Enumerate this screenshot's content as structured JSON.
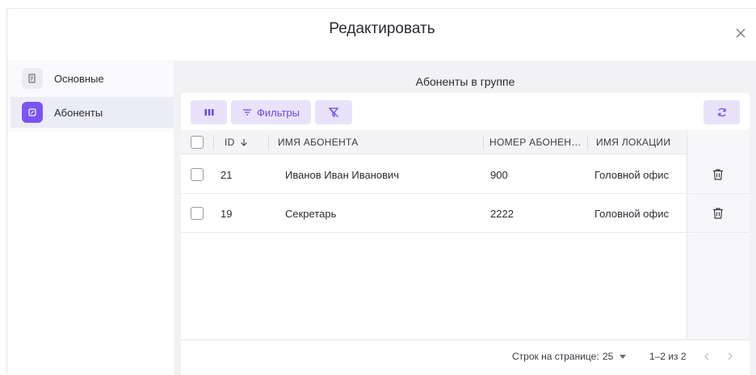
{
  "dialog": {
    "title": "Редактировать",
    "close_icon": "close-icon"
  },
  "sidebar": {
    "items": [
      {
        "label": "Основные",
        "icon": "document-icon",
        "active": false
      },
      {
        "label": "Абоненты",
        "icon": "subscriber-icon",
        "active": true
      }
    ]
  },
  "panel": {
    "title": "Абоненты в группе"
  },
  "toolbar": {
    "columns_icon": "columns-icon",
    "filters_label": "Фильтры",
    "filters_icon": "filter-lines-icon",
    "clear_filters_icon": "filter-clear-icon",
    "refresh_icon": "refresh-icon"
  },
  "table": {
    "headers": {
      "id": "ID",
      "name": "ИМЯ АБОНЕНТА",
      "number": "НОМЕР АБОНЕН…",
      "location": "ИМЯ ЛОКАЦИИ"
    },
    "sort": {
      "column": "id",
      "direction": "desc",
      "icon": "arrow-down-icon"
    },
    "rows": [
      {
        "id": "21",
        "name": "Иванов Иван Иванович",
        "number": "900",
        "location": "Головной офис"
      },
      {
        "id": "19",
        "name": "Секретарь",
        "number": "2222",
        "location": "Головной офис"
      }
    ]
  },
  "footer": {
    "rows_per_page_label": "Строк на странице:",
    "rows_per_page_value": "25",
    "range": "1–2 из 2"
  },
  "colors": {
    "accent": "#6b46f0",
    "accent_light": "#e8e3fb",
    "active_item_bg": "#ececf6"
  }
}
